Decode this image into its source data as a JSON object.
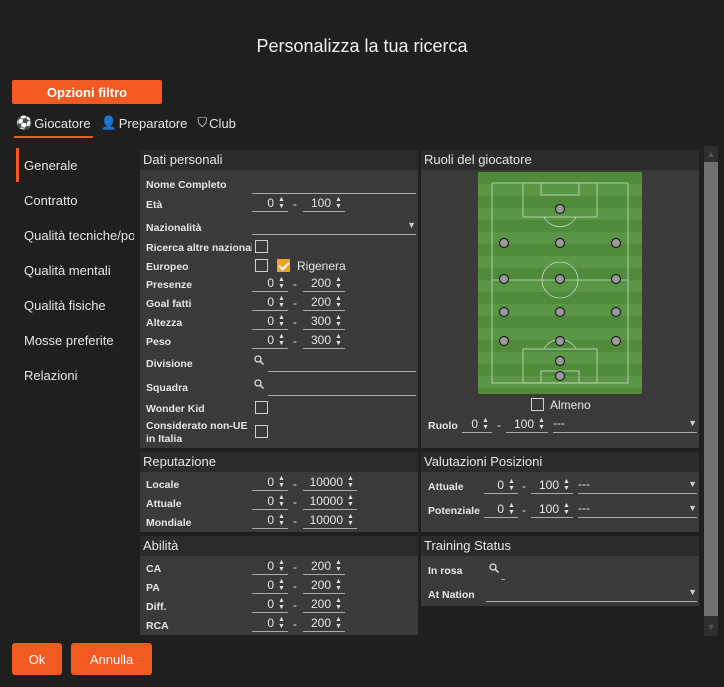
{
  "title": "Personalizza la tua ricerca",
  "filter_button": "Opzioni filtro",
  "tabs": [
    {
      "label": "Giocatore",
      "icon": "player-icon"
    },
    {
      "label": "Preparatore",
      "icon": "coach-icon"
    },
    {
      "label": "Club",
      "icon": "shield-icon"
    }
  ],
  "sidebar": [
    "Generale",
    "Contratto",
    "Qualità tecniche/portiere",
    "Qualità mentali",
    "Qualità fisiche",
    "Mosse preferite",
    "Relazioni"
  ],
  "personal": {
    "header": "Dati personali",
    "nome": "Nome Completo",
    "eta": "Età",
    "eta_min": "0",
    "eta_max": "100",
    "nazionalita": "Nazionalità",
    "ricerca_altre": "Ricerca altre nazionalità",
    "europeo": "Europeo",
    "rigenera": "Rigenera",
    "presenze": "Presenze",
    "presenze_min": "0",
    "presenze_max": "200",
    "goal": "Goal fatti",
    "goal_min": "0",
    "goal_max": "200",
    "altezza": "Altezza",
    "altezza_min": "0",
    "altezza_max": "300",
    "peso": "Peso",
    "peso_min": "0",
    "peso_max": "300",
    "divisione": "Divisione",
    "squadra": "Squadra",
    "wonder": "Wonder Kid",
    "non_ue_1": "Considerato non-UE",
    "non_ue_2": "in Italia"
  },
  "reputation": {
    "header": "Reputazione",
    "locale": "Locale",
    "locale_min": "0",
    "locale_max": "10000",
    "attuale": "Attuale",
    "attuale_min": "0",
    "attuale_max": "10000",
    "mondiale": "Mondiale",
    "mondiale_min": "0",
    "mondiale_max": "10000"
  },
  "ability": {
    "header": "Abilità",
    "ca": "CA",
    "ca_min": "0",
    "ca_max": "200",
    "pa": "PA",
    "pa_min": "0",
    "pa_max": "200",
    "diff": "Diff.",
    "diff_min": "0",
    "diff_max": "200",
    "rca": "RCA",
    "rca_min": "0",
    "rca_max": "200"
  },
  "roles": {
    "header": "Ruoli del giocatore",
    "almeno": "Almeno",
    "ruolo": "Ruolo",
    "ruolo_min": "0",
    "ruolo_max": "100",
    "ruolo_select": "---"
  },
  "valuations": {
    "header": "Valutazioni Posizioni",
    "attuale": "Attuale",
    "attuale_min": "0",
    "attuale_max": "100",
    "attuale_select": "---",
    "potenziale": "Potenziale",
    "potenziale_min": "0",
    "potenziale_max": "100",
    "potenziale_select": "---"
  },
  "training": {
    "header": "Training Status",
    "in_rosa": "In rosa",
    "at_nation": "At Nation"
  },
  "footer": {
    "ok": "Ok",
    "cancel": "Annulla"
  },
  "colors": {
    "accent": "#f25a22",
    "checkbox_on": "#f2a02a",
    "panel": "#3a3a3a",
    "pitch": "#4e8a3a"
  }
}
